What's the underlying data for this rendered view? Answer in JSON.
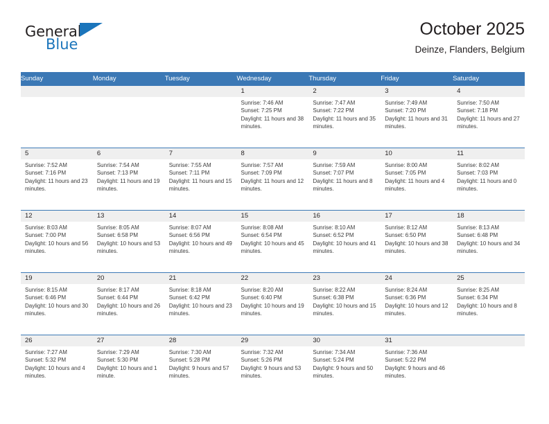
{
  "logo": {
    "word1": "General",
    "word2": "Blue",
    "triangle_color": "#1b75bb",
    "word2_color": "#1b75bb"
  },
  "header": {
    "title": "October 2025",
    "subtitle": "Deinze, Flanders, Belgium"
  },
  "colors": {
    "header_blue": "#3b78b5",
    "daynum_gray": "#efefef",
    "text": "#231f20"
  },
  "weekdays": [
    "Sunday",
    "Monday",
    "Tuesday",
    "Wednesday",
    "Thursday",
    "Friday",
    "Saturday"
  ],
  "weeks": [
    [
      {
        "day": "",
        "lines": []
      },
      {
        "day": "",
        "lines": []
      },
      {
        "day": "",
        "lines": []
      },
      {
        "day": "1",
        "lines": [
          "Sunrise: 7:46 AM",
          "Sunset: 7:25 PM",
          "Daylight: 11 hours and 38 minutes."
        ]
      },
      {
        "day": "2",
        "lines": [
          "Sunrise: 7:47 AM",
          "Sunset: 7:22 PM",
          "Daylight: 11 hours and 35 minutes."
        ]
      },
      {
        "day": "3",
        "lines": [
          "Sunrise: 7:49 AM",
          "Sunset: 7:20 PM",
          "Daylight: 11 hours and 31 minutes."
        ]
      },
      {
        "day": "4",
        "lines": [
          "Sunrise: 7:50 AM",
          "Sunset: 7:18 PM",
          "Daylight: 11 hours and 27 minutes."
        ]
      }
    ],
    [
      {
        "day": "5",
        "lines": [
          "Sunrise: 7:52 AM",
          "Sunset: 7:16 PM",
          "Daylight: 11 hours and 23 minutes."
        ]
      },
      {
        "day": "6",
        "lines": [
          "Sunrise: 7:54 AM",
          "Sunset: 7:13 PM",
          "Daylight: 11 hours and 19 minutes."
        ]
      },
      {
        "day": "7",
        "lines": [
          "Sunrise: 7:55 AM",
          "Sunset: 7:11 PM",
          "Daylight: 11 hours and 15 minutes."
        ]
      },
      {
        "day": "8",
        "lines": [
          "Sunrise: 7:57 AM",
          "Sunset: 7:09 PM",
          "Daylight: 11 hours and 12 minutes."
        ]
      },
      {
        "day": "9",
        "lines": [
          "Sunrise: 7:59 AM",
          "Sunset: 7:07 PM",
          "Daylight: 11 hours and 8 minutes."
        ]
      },
      {
        "day": "10",
        "lines": [
          "Sunrise: 8:00 AM",
          "Sunset: 7:05 PM",
          "Daylight: 11 hours and 4 minutes."
        ]
      },
      {
        "day": "11",
        "lines": [
          "Sunrise: 8:02 AM",
          "Sunset: 7:03 PM",
          "Daylight: 11 hours and 0 minutes."
        ]
      }
    ],
    [
      {
        "day": "12",
        "lines": [
          "Sunrise: 8:03 AM",
          "Sunset: 7:00 PM",
          "Daylight: 10 hours and 56 minutes."
        ]
      },
      {
        "day": "13",
        "lines": [
          "Sunrise: 8:05 AM",
          "Sunset: 6:58 PM",
          "Daylight: 10 hours and 53 minutes."
        ]
      },
      {
        "day": "14",
        "lines": [
          "Sunrise: 8:07 AM",
          "Sunset: 6:56 PM",
          "Daylight: 10 hours and 49 minutes."
        ]
      },
      {
        "day": "15",
        "lines": [
          "Sunrise: 8:08 AM",
          "Sunset: 6:54 PM",
          "Daylight: 10 hours and 45 minutes."
        ]
      },
      {
        "day": "16",
        "lines": [
          "Sunrise: 8:10 AM",
          "Sunset: 6:52 PM",
          "Daylight: 10 hours and 41 minutes."
        ]
      },
      {
        "day": "17",
        "lines": [
          "Sunrise: 8:12 AM",
          "Sunset: 6:50 PM",
          "Daylight: 10 hours and 38 minutes."
        ]
      },
      {
        "day": "18",
        "lines": [
          "Sunrise: 8:13 AM",
          "Sunset: 6:48 PM",
          "Daylight: 10 hours and 34 minutes."
        ]
      }
    ],
    [
      {
        "day": "19",
        "lines": [
          "Sunrise: 8:15 AM",
          "Sunset: 6:46 PM",
          "Daylight: 10 hours and 30 minutes."
        ]
      },
      {
        "day": "20",
        "lines": [
          "Sunrise: 8:17 AM",
          "Sunset: 6:44 PM",
          "Daylight: 10 hours and 26 minutes."
        ]
      },
      {
        "day": "21",
        "lines": [
          "Sunrise: 8:18 AM",
          "Sunset: 6:42 PM",
          "Daylight: 10 hours and 23 minutes."
        ]
      },
      {
        "day": "22",
        "lines": [
          "Sunrise: 8:20 AM",
          "Sunset: 6:40 PM",
          "Daylight: 10 hours and 19 minutes."
        ]
      },
      {
        "day": "23",
        "lines": [
          "Sunrise: 8:22 AM",
          "Sunset: 6:38 PM",
          "Daylight: 10 hours and 15 minutes."
        ]
      },
      {
        "day": "24",
        "lines": [
          "Sunrise: 8:24 AM",
          "Sunset: 6:36 PM",
          "Daylight: 10 hours and 12 minutes."
        ]
      },
      {
        "day": "25",
        "lines": [
          "Sunrise: 8:25 AM",
          "Sunset: 6:34 PM",
          "Daylight: 10 hours and 8 minutes."
        ]
      }
    ],
    [
      {
        "day": "26",
        "lines": [
          "Sunrise: 7:27 AM",
          "Sunset: 5:32 PM",
          "Daylight: 10 hours and 4 minutes."
        ]
      },
      {
        "day": "27",
        "lines": [
          "Sunrise: 7:29 AM",
          "Sunset: 5:30 PM",
          "Daylight: 10 hours and 1 minute."
        ]
      },
      {
        "day": "28",
        "lines": [
          "Sunrise: 7:30 AM",
          "Sunset: 5:28 PM",
          "Daylight: 9 hours and 57 minutes."
        ]
      },
      {
        "day": "29",
        "lines": [
          "Sunrise: 7:32 AM",
          "Sunset: 5:26 PM",
          "Daylight: 9 hours and 53 minutes."
        ]
      },
      {
        "day": "30",
        "lines": [
          "Sunrise: 7:34 AM",
          "Sunset: 5:24 PM",
          "Daylight: 9 hours and 50 minutes."
        ]
      },
      {
        "day": "31",
        "lines": [
          "Sunrise: 7:36 AM",
          "Sunset: 5:22 PM",
          "Daylight: 9 hours and 46 minutes."
        ]
      },
      {
        "day": "",
        "lines": []
      }
    ]
  ]
}
